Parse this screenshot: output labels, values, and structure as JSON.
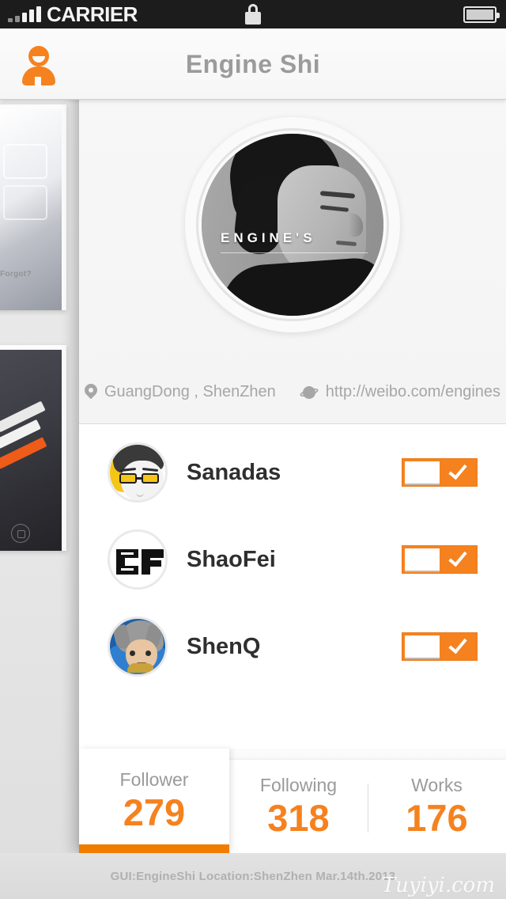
{
  "status_bar": {
    "carrier": "CARRIER",
    "lock_icon": "lock-icon",
    "battery_icon": "battery-icon",
    "signal_icon": "signal-bars-icon"
  },
  "nav": {
    "title": "Engine Shi",
    "profile_icon": "person-icon"
  },
  "profile": {
    "avatar_overlay_text": "ENGINE'S",
    "location_icon": "map-pin-icon",
    "location": "GuangDong , ShenZhen",
    "website_icon": "globe-icon",
    "website": "http://weibo.com/engines"
  },
  "friends": [
    {
      "name": "Sanadas",
      "avatar": "avatar-sanadas",
      "toggle_on": true,
      "toggle_icon": "check-icon"
    },
    {
      "name": "ShaoFei",
      "avatar": "avatar-shaofei",
      "toggle_on": true,
      "toggle_icon": "check-icon"
    },
    {
      "name": "ShenQ",
      "avatar": "avatar-shenq",
      "toggle_on": true,
      "toggle_icon": "check-icon"
    }
  ],
  "tabs": [
    {
      "label": "Follower",
      "value": "279",
      "active": true
    },
    {
      "label": "Following",
      "value": "318",
      "active": false
    },
    {
      "label": "Works",
      "value": "176",
      "active": false
    }
  ],
  "footer": {
    "text": "GUI:EngineShi  Location:ShenZhen  Mar.14th.2013",
    "watermark": "Tuyiyi.com"
  },
  "colors": {
    "accent_orange": "#f5821f",
    "accent_orange_dark": "#f07d00",
    "title_gray": "#9b9b9b",
    "meta_gray": "#a6a6a6",
    "name_dark": "#2f2f2f",
    "status_bar_bg": "#1c1c1c"
  },
  "background_cards": {
    "card_one_caption": "Forgot?"
  }
}
